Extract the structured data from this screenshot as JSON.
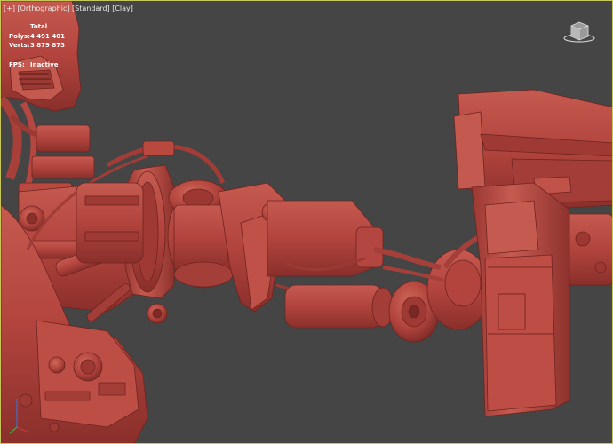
{
  "viewport": {
    "label_parts": [
      "[+]",
      "[Orthographic]",
      "[Standard]",
      "[Clay]"
    ],
    "background": "#454545",
    "clay_color": "#b5453f"
  },
  "stats": {
    "title": "Total",
    "polys_label": "Polys:",
    "polys_value": "4 491 401",
    "verts_label": "Verts:",
    "verts_value": "3 879 873",
    "fps_label": "FPS:",
    "fps_value": "Inactive"
  },
  "icons": {
    "viewcube": "viewcube-icon",
    "axis": "axis-gizmo-icon"
  }
}
